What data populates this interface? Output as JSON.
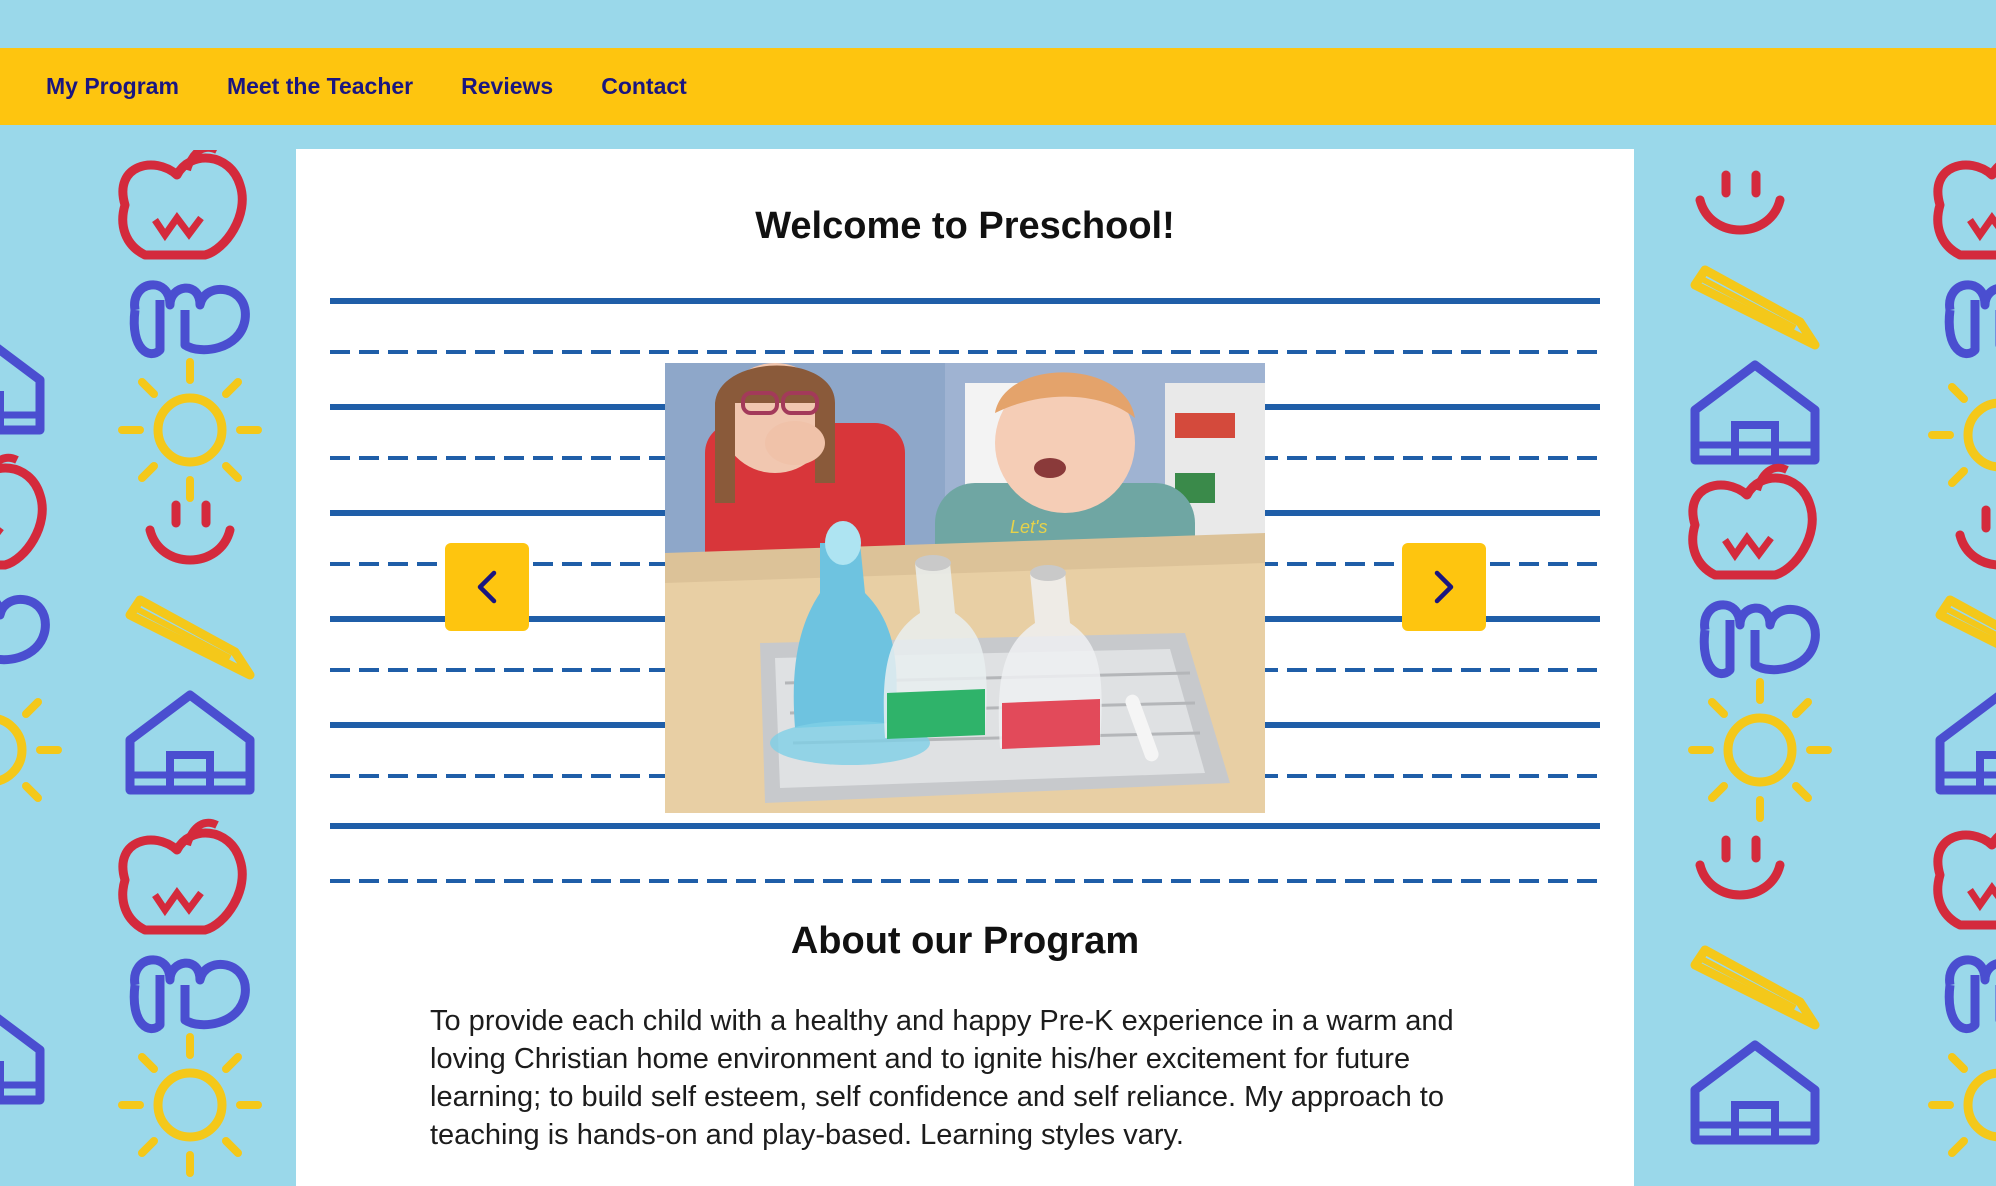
{
  "nav": {
    "items": [
      {
        "label": "My Program"
      },
      {
        "label": "Meet the Teacher"
      },
      {
        "label": "Reviews"
      },
      {
        "label": "Contact"
      }
    ]
  },
  "hero": {
    "title": "Welcome to Preschool!"
  },
  "slideshow": {
    "prev_icon": "chevron-left-icon",
    "next_icon": "chevron-right-icon",
    "slide_image": "children-doing-bottle-science-experiment"
  },
  "about": {
    "heading": "About our Program",
    "body": "To provide each child with a healthy and happy Pre-K experience in a warm and loving Christian home environment and to ignite his/her excitement for future learning; to build self esteem, self confidence and self reliance. My approach to teaching is hands-on and play-based. Learning styles vary."
  },
  "colors": {
    "background": "#9ad8ea",
    "nav_bar": "#fec50f",
    "nav_text": "#1a1680",
    "card": "#ffffff",
    "writing_lines": "#1f5ea8",
    "doodle_red": "#d42a3c",
    "doodle_blue": "#4a4ed0",
    "doodle_yellow": "#f4c81a"
  }
}
